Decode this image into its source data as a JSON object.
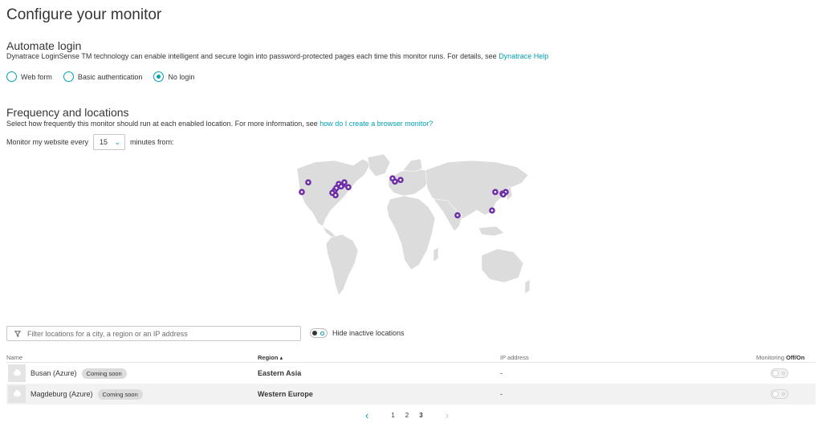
{
  "page": {
    "title": "Configure your monitor"
  },
  "login": {
    "heading": "Automate login",
    "description": "Dynatrace LoginSense TM technology can enable intelligent and secure login into password-protected pages each time this monitor runs. For details, see ",
    "help_link": "Dynatrace Help",
    "options": [
      {
        "label": "Web form",
        "checked": false
      },
      {
        "label": "Basic authentication",
        "checked": false
      },
      {
        "label": "No login",
        "checked": true
      }
    ]
  },
  "frequency": {
    "heading": "Frequency and locations",
    "description": "Select how frequently this monitor should run at each enabled location. For more information, see ",
    "help_link": "how do I create a browser monitor?",
    "prefix": "Monitor my website every",
    "value": "15",
    "suffix": "minutes from:"
  },
  "map": {
    "marker_color": "#6f2da8",
    "land_color": "#dcdcdc",
    "marker_count": 20
  },
  "filter": {
    "placeholder": "Filter locations for a city, a region or an IP address",
    "hide_inactive_label": "Hide inactive locations",
    "hide_inactive_on": true
  },
  "table": {
    "columns": {
      "name": "Name",
      "region": "Region ▴",
      "ip": "IP address",
      "monitoring_prefix": "Monitoring ",
      "monitoring_bold": "Off/On"
    },
    "rows": [
      {
        "name": "Busan (Azure)",
        "badge": "Coming soon",
        "region": "Eastern Asia",
        "ip": "-",
        "monitoring": false
      },
      {
        "name": "Magdeburg (Azure)",
        "badge": "Coming soon",
        "region": "Western Europe",
        "ip": "-",
        "monitoring": false
      }
    ]
  },
  "pagination": {
    "pages": [
      "1",
      "2",
      "3"
    ],
    "current": "3",
    "prev": "‹",
    "next": "›"
  }
}
